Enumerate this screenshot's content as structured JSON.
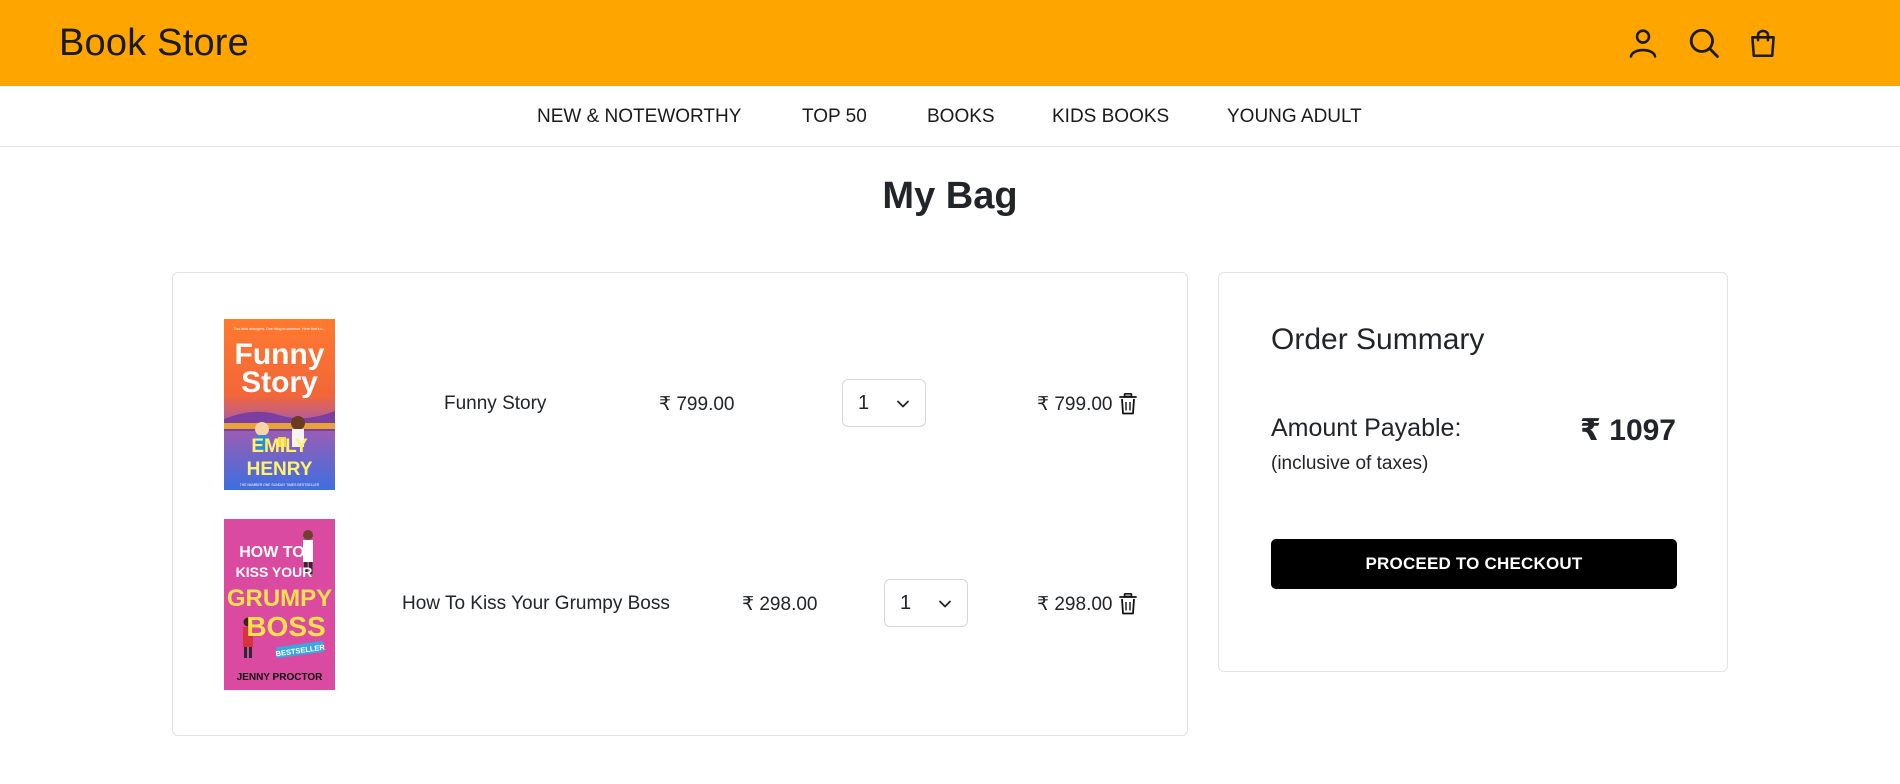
{
  "header": {
    "brand": "Book Store",
    "icons": [
      "user-icon",
      "search-icon",
      "bag-icon"
    ],
    "bg_color": "#ffa500"
  },
  "nav": {
    "items": [
      "NEW & NOTEWORTHY",
      "TOP 50",
      "BOOKS",
      "KIDS BOOKS",
      "YOUNG ADULT"
    ]
  },
  "page": {
    "title": "My Bag"
  },
  "cart": {
    "items": [
      {
        "title": "Funny Story",
        "price": "₹ 799.00",
        "qty": "1",
        "total": "₹ 799.00",
        "cover": {
          "tagline": "Two total strangers. One thing in common. Here that's a...",
          "title_line1": "Funny",
          "title_line2": "Story",
          "author_line1": "EMILY",
          "author_line2": "HENRY",
          "footer": "THE NUMBER ONE SUNDAY TIMES BESTSELLER"
        }
      },
      {
        "title": "How To Kiss Your Grumpy Boss",
        "price": "₹ 298.00",
        "qty": "1",
        "total": "₹ 298.00",
        "cover": {
          "title_line1": "HOW TO",
          "title_line2": "KISS YOUR",
          "title_line3": "GRUMPY",
          "title_line4": "BOSS",
          "badge": "BESTSELLER",
          "author": "JENNY PROCTOR"
        }
      }
    ]
  },
  "summary": {
    "title": "Order Summary",
    "amount_label": "Amount Payable:",
    "amount_note": "(inclusive of taxes)",
    "amount_value": "₹ 1097",
    "checkout_label": "PROCEED TO CHECKOUT"
  }
}
